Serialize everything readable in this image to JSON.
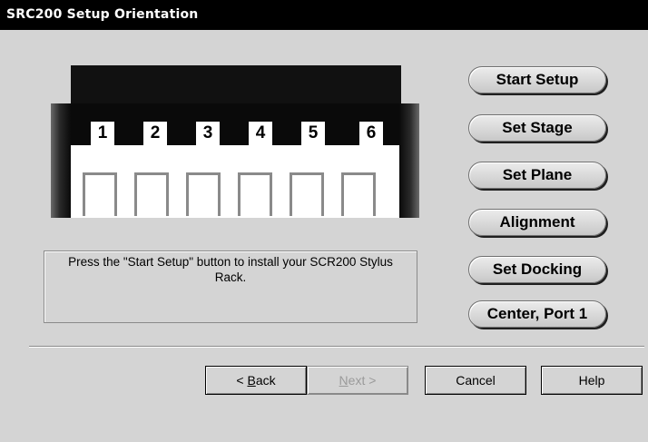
{
  "window": {
    "title": "SRC200 Setup Orientation"
  },
  "rack": {
    "slots": [
      "1",
      "2",
      "3",
      "4",
      "5",
      "6"
    ]
  },
  "info_text": "Press the \"Start Setup\" button to install your SCR200 Stylus Rack.",
  "side_buttons": [
    "Start Setup",
    "Set Stage",
    "Set Plane",
    "Alignment",
    "Set Docking",
    "Center, Port 1"
  ],
  "footer": {
    "back": {
      "prefix": "< ",
      "accel": "B",
      "rest": "ack"
    },
    "next": {
      "accel": "N",
      "rest": "ext",
      "suffix": " >",
      "enabled": false
    },
    "cancel": "Cancel",
    "help": "Help"
  }
}
